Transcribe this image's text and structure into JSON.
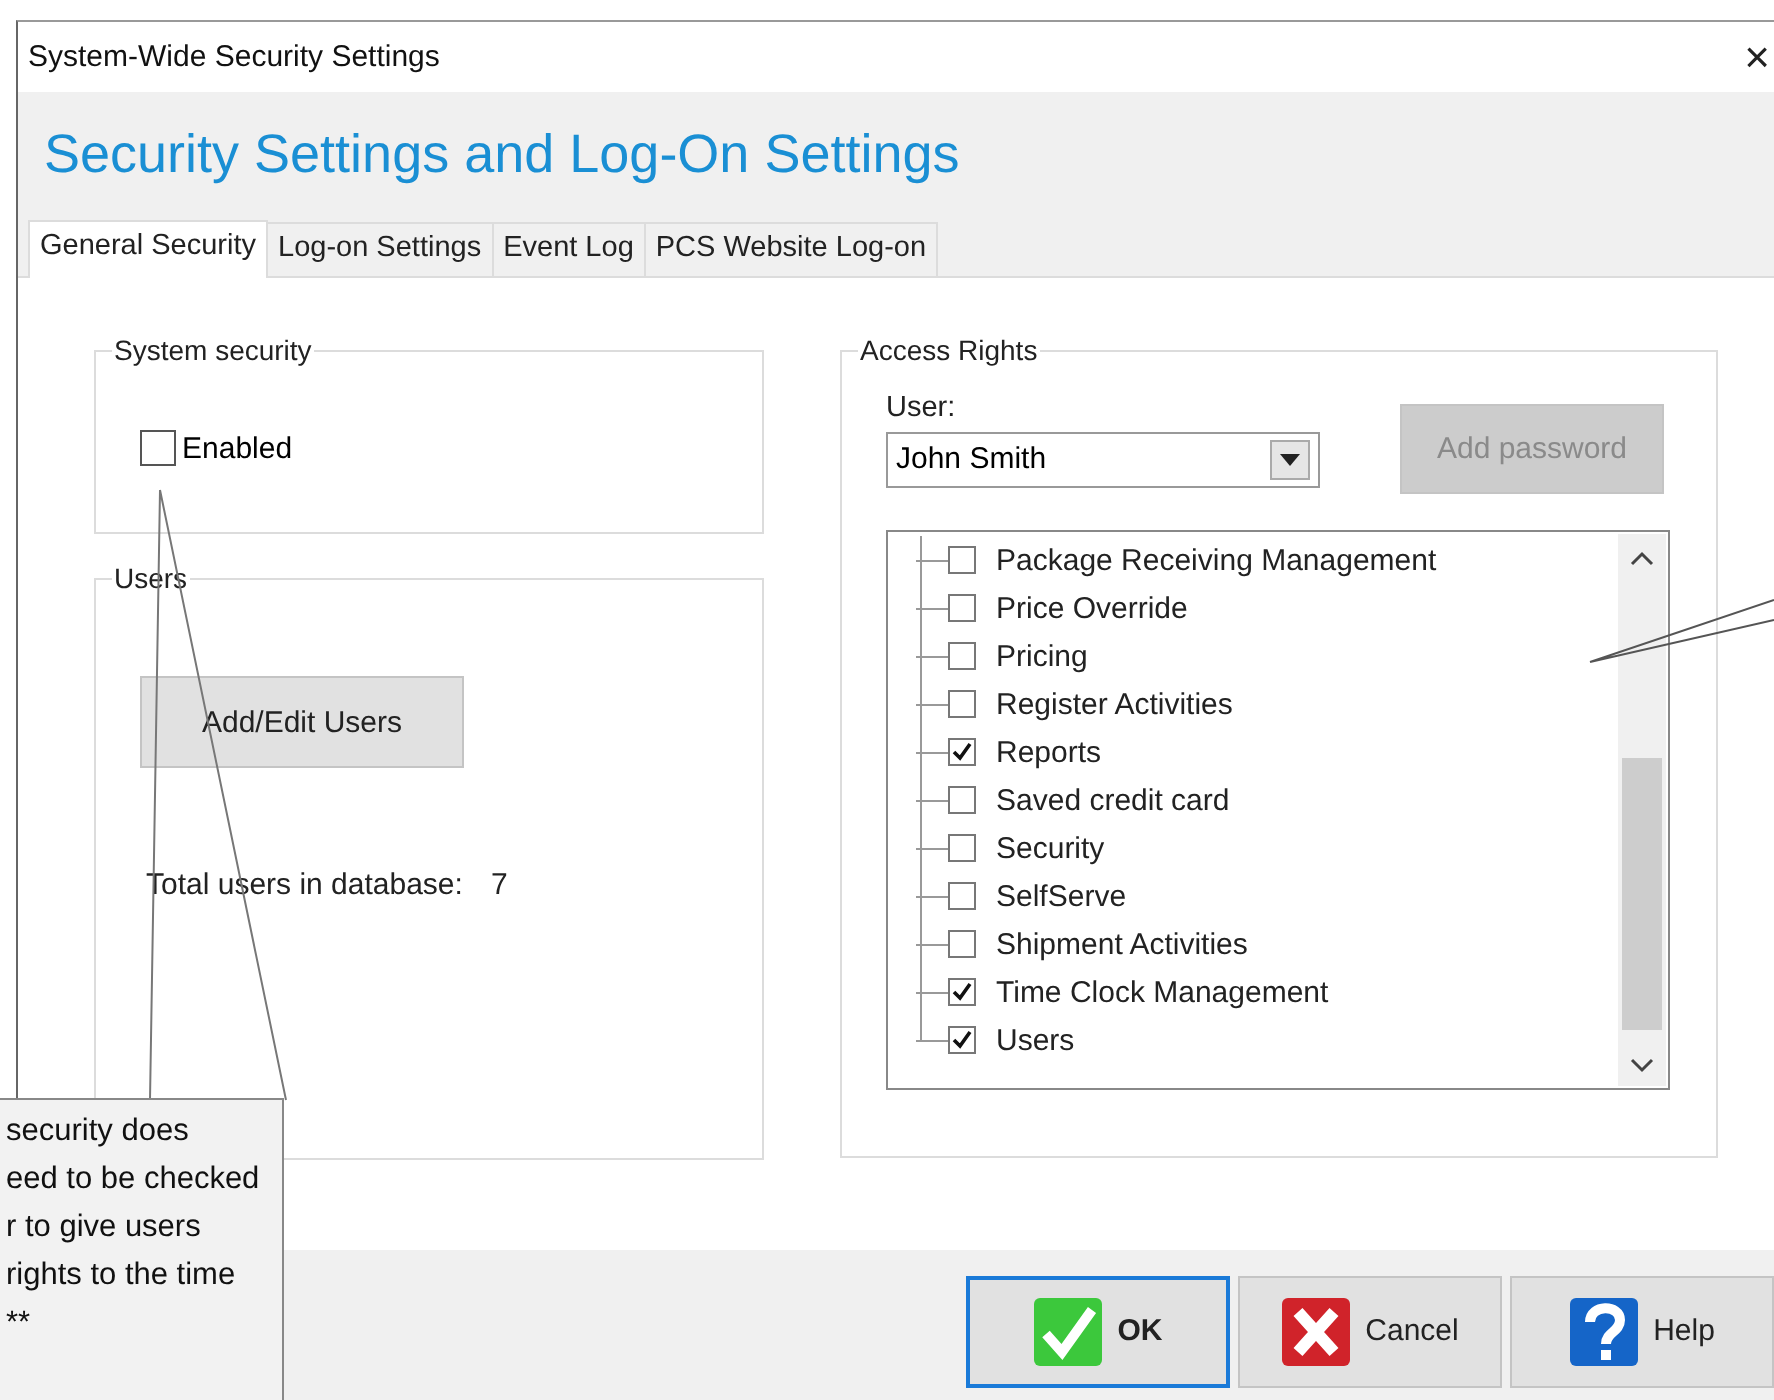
{
  "window": {
    "title": "System-Wide Security Settings",
    "close": "×"
  },
  "header": {
    "title": "Security Settings and Log-On Settings"
  },
  "tabs": [
    {
      "label": "General Security",
      "selected": true
    },
    {
      "label": "Log-on Settings",
      "selected": false
    },
    {
      "label": "Event Log",
      "selected": false
    },
    {
      "label": "PCS Website Log-on",
      "selected": false
    }
  ],
  "system_security": {
    "title": "System security",
    "checkbox": {
      "label": "Enabled",
      "checked": false
    }
  },
  "users": {
    "title": "Users",
    "button": "Add/Edit Users",
    "count_label": "Total users in database:",
    "count": "7"
  },
  "access_rights": {
    "title": "Access Rights",
    "user_label": "User:",
    "user": "John Smith",
    "add_password": {
      "label": "Add password",
      "disabled": true
    },
    "items": [
      {
        "label": "Package Receiving Management",
        "checked": false
      },
      {
        "label": "Price Override",
        "checked": false
      },
      {
        "label": "Pricing",
        "checked": false
      },
      {
        "label": "Register Activities",
        "checked": false
      },
      {
        "label": "Reports",
        "checked": true
      },
      {
        "label": "Saved credit card",
        "checked": false
      },
      {
        "label": "Security",
        "checked": false
      },
      {
        "label": "SelfServe",
        "checked": false
      },
      {
        "label": "Shipment Activities",
        "checked": false
      },
      {
        "label": "Time Clock Management",
        "checked": true
      },
      {
        "label": "Users",
        "checked": true
      }
    ]
  },
  "buttons": [
    {
      "kind": "ok",
      "label": "OK",
      "focused": true
    },
    {
      "kind": "cancel",
      "label": "Cancel",
      "focused": false
    },
    {
      "kind": "help",
      "label": "Help",
      "focused": false
    }
  ],
  "callout": {
    "text": "security does\need to be checked\nr to give users\nrights to the time\n**"
  }
}
